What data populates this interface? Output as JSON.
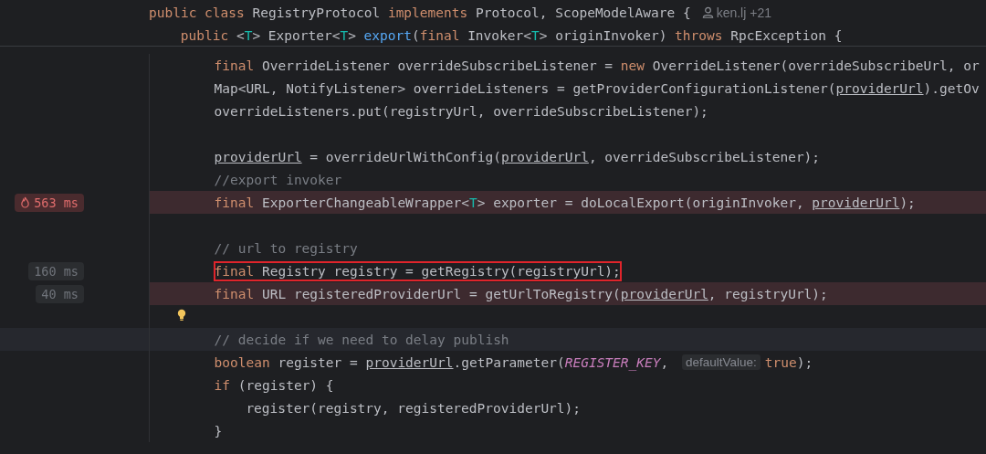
{
  "sticky_header": {
    "lines": [
      {
        "kind": "class",
        "tokens": [
          {
            "kind": "kw",
            "s": "public class "
          },
          {
            "kind": "p",
            "s": "RegistryProtocol "
          },
          {
            "kind": "kw",
            "s": "implements "
          },
          {
            "kind": "p",
            "s": "Protocol, ScopeModelAware {"
          }
        ],
        "author": "ken.lj +21"
      },
      {
        "kind": "method",
        "tokens": [
          {
            "kind": "kw",
            "s": "public "
          },
          {
            "kind": "p",
            "s": "<"
          },
          {
            "kind": "tp",
            "s": "T"
          },
          {
            "kind": "p",
            "s": "> Exporter<"
          },
          {
            "kind": "tp",
            "s": "T"
          },
          {
            "kind": "p",
            "s": "> "
          },
          {
            "kind": "m",
            "s": "export"
          },
          {
            "kind": "p",
            "s": "("
          },
          {
            "kind": "kw",
            "s": "final "
          },
          {
            "kind": "p",
            "s": "Invoker<"
          },
          {
            "kind": "tp",
            "s": "T"
          },
          {
            "kind": "p",
            "s": "> originInvoker) "
          },
          {
            "kind": "kw",
            "s": "throws "
          },
          {
            "kind": "p",
            "s": "RpcException {"
          }
        ]
      }
    ]
  },
  "lines": [
    {
      "kind": "statement",
      "tokens": [
        {
          "kind": "kw",
          "s": "final "
        },
        {
          "kind": "p",
          "s": "OverrideListener overrideSubscribeListener = "
        },
        {
          "kind": "kw",
          "s": "new "
        },
        {
          "kind": "p",
          "s": "OverrideListener(overrideSubscribeUrl, or"
        }
      ]
    },
    {
      "kind": "statement",
      "tokens": [
        {
          "kind": "p",
          "s": "Map<URL, NotifyListener> overrideListeners = getProviderConfigurationListener("
        },
        {
          "kind": "u",
          "s": "providerUrl"
        },
        {
          "kind": "p",
          "s": ").getOv"
        }
      ]
    },
    {
      "kind": "statement",
      "tokens": [
        {
          "kind": "p",
          "s": "overrideListeners.put(registryUrl, overrideSubscribeListener);"
        }
      ]
    },
    {
      "kind": "statement"
    },
    {
      "kind": "statement",
      "tokens": [
        {
          "kind": "u",
          "s": "providerUrl"
        },
        {
          "kind": "p",
          "s": " = overrideUrlWithConfig("
        },
        {
          "kind": "u",
          "s": "providerUrl"
        },
        {
          "kind": "p",
          "s": ", overrideSubscribeListener);"
        }
      ]
    },
    {
      "kind": "statement",
      "tokens": [
        {
          "kind": "c",
          "s": "//export invoker"
        }
      ]
    },
    {
      "kind": "statement",
      "error": true,
      "timing": {
        "text": "563 ms",
        "kind": "hot"
      },
      "tokens": [
        {
          "kind": "kw",
          "s": "final "
        },
        {
          "kind": "p",
          "s": "ExporterChangeableWrapper<"
        },
        {
          "kind": "tp",
          "s": "T"
        },
        {
          "kind": "p",
          "s": "> exporter = doLocalExport(originInvoker, "
        },
        {
          "kind": "u",
          "s": "providerUrl"
        },
        {
          "kind": "p",
          "s": ");"
        }
      ]
    },
    {
      "kind": "statement"
    },
    {
      "kind": "statement",
      "tokens": [
        {
          "kind": "c",
          "s": "// url to registry"
        }
      ]
    },
    {
      "kind": "statement",
      "boxed": true,
      "timing": {
        "text": "160 ms",
        "kind": "normal"
      },
      "tokens": [
        {
          "kind": "kw",
          "s": "final "
        },
        {
          "kind": "p",
          "s": "Registry registry = getRegistry(registryUrl);"
        }
      ]
    },
    {
      "kind": "statement",
      "error": true,
      "timing": {
        "text": "40 ms",
        "kind": "normal"
      },
      "tokens": [
        {
          "kind": "kw",
          "s": "final "
        },
        {
          "kind": "p",
          "s": "URL registeredProviderUrl = getUrlToRegistry("
        },
        {
          "kind": "u",
          "s": "providerUrl"
        },
        {
          "kind": "p",
          "s": ", registryUrl);"
        }
      ]
    },
    {
      "kind": "statement",
      "bulb": true
    },
    {
      "kind": "statement",
      "current": true,
      "tokens": [
        {
          "kind": "c",
          "s": "// decide if we need to delay publish"
        }
      ]
    },
    {
      "kind": "statement",
      "tokens": [
        {
          "kind": "kw",
          "s": "boolean "
        },
        {
          "kind": "p",
          "s": "register = "
        },
        {
          "kind": "u",
          "s": "providerUrl"
        },
        {
          "kind": "p",
          "s": ".getParameter("
        },
        {
          "kind": "k",
          "s": "REGISTER_KEY"
        },
        {
          "kind": "p",
          "s": ", "
        },
        {
          "kind": "hint",
          "s": "defaultValue:"
        },
        {
          "kind": "kw",
          "s": "true"
        },
        {
          "kind": "p",
          "s": ");"
        }
      ]
    },
    {
      "kind": "statement",
      "tokens": [
        {
          "kind": "kw",
          "s": "if "
        },
        {
          "kind": "p",
          "s": "(register) {"
        }
      ]
    },
    {
      "kind": "nested",
      "tokens": [
        {
          "kind": "p",
          "s": "register(registry, registeredProviderUrl);"
        }
      ]
    },
    {
      "kind": "statement",
      "tokens": [
        {
          "kind": "p",
          "s": "}"
        }
      ]
    }
  ]
}
